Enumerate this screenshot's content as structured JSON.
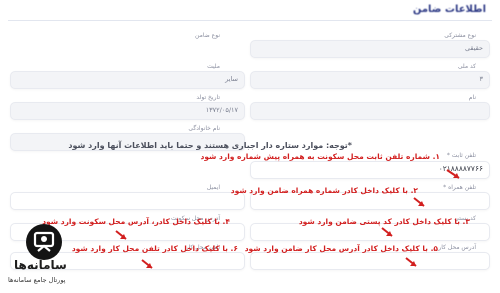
{
  "page": {
    "title": "اطلاعات ضامن"
  },
  "fields": {
    "guarantor_type": {
      "label": "نوع ضامن"
    },
    "subscriber_type": {
      "label": "نوع مشترکی",
      "value": "حقیقی"
    },
    "nationality": {
      "label": "ملیت",
      "value": "سایر"
    },
    "national_code": {
      "label": "کد ملی",
      "value": "۳"
    },
    "birth_date": {
      "label": "تاریخ تولد",
      "value": "۱۳۷۲/۰۵/۱۷"
    },
    "name": {
      "label": "نام"
    },
    "family_name": {
      "label": "نام خانوادگی"
    },
    "landline": {
      "label": "تلفن ثابت *",
      "value": "۰۲۱۸۸۸۸۷۷۶۶"
    },
    "mobile": {
      "label": "تلفن همراه *"
    },
    "email": {
      "label": "ایمیل"
    },
    "postal_code": {
      "label": "کد پستی"
    },
    "residence_address": {
      "label": "آدرس محل سکونت"
    },
    "work_address": {
      "label": "آدرس محل کار"
    },
    "work_phone": {
      "label": "تلفن محل کار"
    }
  },
  "notes": {
    "required": "*توجه: موارد ستاره دار اجباری هستند و حتما باید اطلاعات آنها وارد شود"
  },
  "hints": {
    "h1": "۱. شماره تلفن ثابت محل سکونت به همراه پیش شماره وارد شود",
    "h2": "۲. با کلیک داخل کادر شماره همراه ضامن وارد شود",
    "h3": "۳. با کلیک داخل کادر کد پستی ضامن وارد شود",
    "h4": "۴. با کلیک داخل کادر، آدرس محل سکونت وارد شود",
    "h5": "۵. با کلیک داخل کادر آدرس محل کار ضامن وارد شود",
    "h6": "۶. با کلیک داخل کادر تلفن محل کار وارد شود"
  },
  "logo": {
    "name": "سامانه‌ها",
    "subtitle": "پورتال جامع سامانه‌ها"
  },
  "colors": {
    "hint": "#d21f1f",
    "title": "#2f3b86"
  }
}
